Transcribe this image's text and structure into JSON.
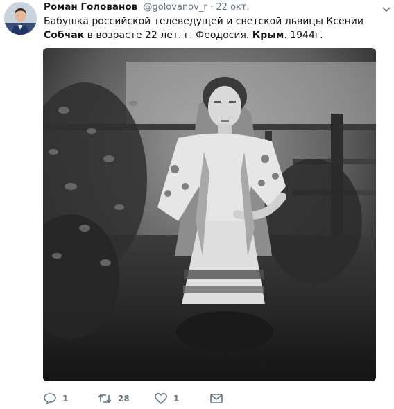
{
  "tweet": {
    "author_name": "Роман Голованов",
    "author_handle": "@golovanov_r",
    "separator": "·",
    "timestamp": "22 окт.",
    "text_parts": [
      "Бабушка российской телеведущей и светской львицы Ксении ",
      "Собчак",
      " в возрасте 22 лет. г. Феодосия. ",
      "Крым",
      ". 1944г."
    ]
  },
  "actions": {
    "reply_count": "1",
    "retweet_count": "28",
    "like_count": "1"
  },
  "icons": {
    "avatar": "avatar",
    "caret": "chevron-down-icon",
    "reply": "reply-icon",
    "retweet": "retweet-icon",
    "like": "heart-icon",
    "message": "envelope-icon"
  },
  "colors": {
    "text": "#14171a",
    "secondary": "#657786"
  }
}
